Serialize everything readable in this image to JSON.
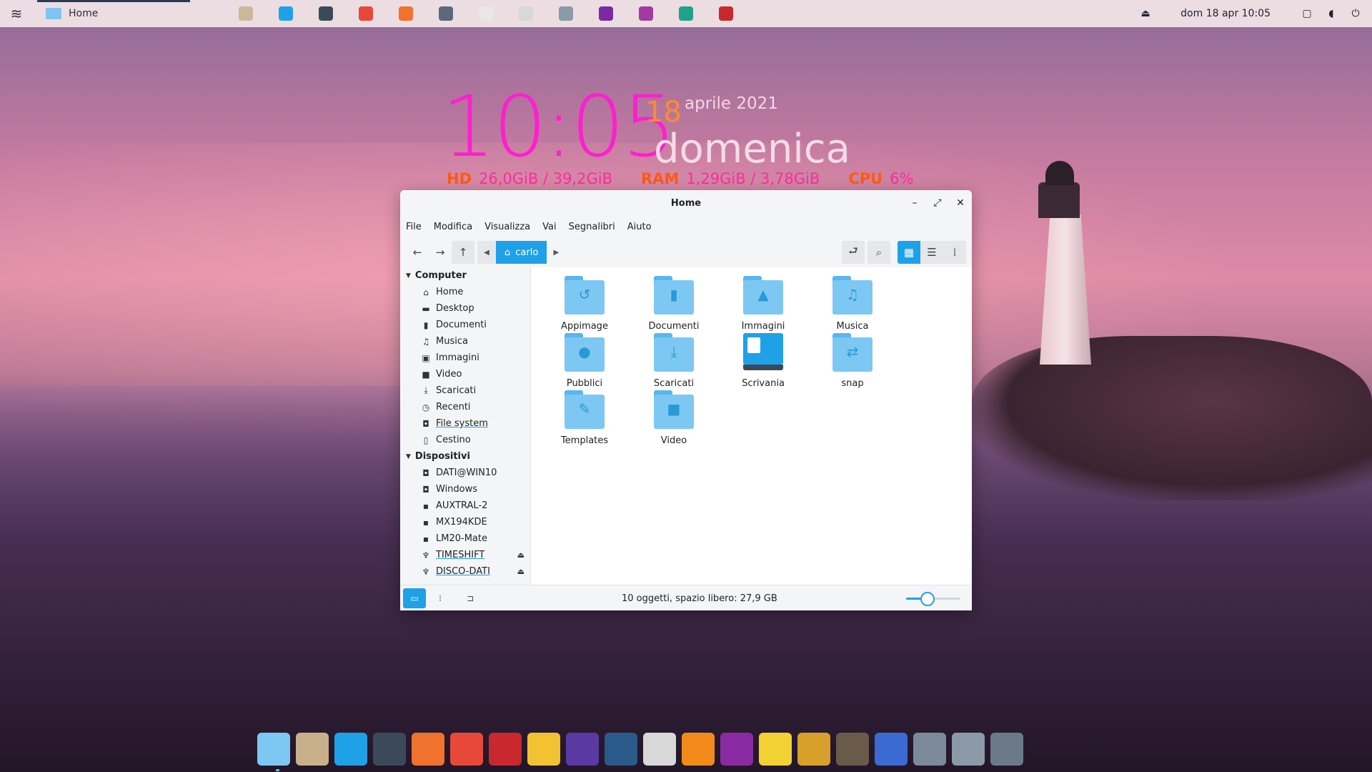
{
  "top_panel": {
    "active_window": "Home",
    "clock": "dom 18 apr  10:05",
    "launchers": [
      "file-manager",
      "software-center",
      "terminal",
      "chrome",
      "firefox",
      "calculator",
      "text-editor",
      "scanner",
      "screenshot",
      "video-recorder",
      "media",
      "audio",
      "cm-app"
    ],
    "tray_icons": [
      "eject-icon",
      "screen-icon",
      "volume-icon",
      "power-icon"
    ]
  },
  "conky": {
    "time": "10:05",
    "day": "18",
    "month_year": "aprile 2021",
    "weekday": "domenica",
    "hd_label": "HD",
    "hd_value": "26,0GiB / 39,2GiB",
    "ram_label": "RAM",
    "ram_value": "1,29GiB / 3,78GiB",
    "cpu_label": "CPU",
    "cpu_value": "6%"
  },
  "window": {
    "title": "Home",
    "menu": [
      "File",
      "Modifica",
      "Visualizza",
      "Vai",
      "Segnalibri",
      "Aiuto"
    ],
    "breadcrumb": "carlo",
    "sidebar": {
      "computer_heading": "Computer",
      "computer_items": [
        {
          "label": "Home",
          "icon": "home-icon",
          "glyph": "⌂"
        },
        {
          "label": "Desktop",
          "icon": "desktop-icon",
          "glyph": "▬"
        },
        {
          "label": "Documenti",
          "icon": "document-icon",
          "glyph": "▮"
        },
        {
          "label": "Musica",
          "icon": "music-icon",
          "glyph": "♫"
        },
        {
          "label": "Immagini",
          "icon": "image-icon",
          "glyph": "▣"
        },
        {
          "label": "Video",
          "icon": "video-icon",
          "glyph": "■"
        },
        {
          "label": "Scaricati",
          "icon": "download-icon",
          "glyph": "⤓"
        },
        {
          "label": "Recenti",
          "icon": "clock-icon",
          "glyph": "◷"
        },
        {
          "label": "File system",
          "icon": "drive-icon",
          "glyph": "◘"
        },
        {
          "label": "Cestino",
          "icon": "trash-icon",
          "glyph": "▯"
        }
      ],
      "devices_heading": "Dispositivi",
      "device_items": [
        {
          "label": "DATI@WIN10",
          "icon": "drive-icon",
          "glyph": "◘"
        },
        {
          "label": "Windows",
          "icon": "drive-icon",
          "glyph": "◘"
        },
        {
          "label": "AUXTRAL-2",
          "icon": "drive-icon",
          "glyph": "▪"
        },
        {
          "label": "MX194KDE",
          "icon": "drive-icon",
          "glyph": "▪"
        },
        {
          "label": "LM20-Mate",
          "icon": "drive-icon",
          "glyph": "▪"
        },
        {
          "label": "TIMESHIFT",
          "icon": "usb-icon",
          "glyph": "♆",
          "eject": "⏏"
        },
        {
          "label": "DISCO-DATI",
          "icon": "usb-icon",
          "glyph": "♆",
          "eject": "⏏"
        }
      ]
    },
    "files": [
      {
        "name": "Appimage",
        "icon": "folder-appimage-icon",
        "glyph": "↺"
      },
      {
        "name": "Documenti",
        "icon": "folder-documents-icon",
        "glyph": "▮"
      },
      {
        "name": "Immagini",
        "icon": "folder-pictures-icon",
        "glyph": "▲"
      },
      {
        "name": "Musica",
        "icon": "folder-music-icon",
        "glyph": "♫"
      },
      {
        "name": "Pubblici",
        "icon": "folder-public-icon",
        "glyph": "●"
      },
      {
        "name": "Scaricati",
        "icon": "folder-download-icon",
        "glyph": "⤓"
      },
      {
        "name": "Scrivania",
        "icon": "desktop-folder-icon",
        "glyph": ""
      },
      {
        "name": "snap",
        "icon": "folder-snap-icon",
        "glyph": "⇄"
      },
      {
        "name": "Templates",
        "icon": "folder-templates-icon",
        "glyph": "✎"
      },
      {
        "name": "Video",
        "icon": "folder-video-icon",
        "glyph": "■"
      }
    ],
    "status": "10 oggetti, spazio libero: 27,9 GB",
    "zoom_level": 0.38
  },
  "dock": [
    {
      "name": "files-dock-icon",
      "color": "#7cc8f2"
    },
    {
      "name": "archive-dock-icon",
      "color": "#c8b08a"
    },
    {
      "name": "software-dock-icon",
      "color": "#1fa1e8"
    },
    {
      "name": "terminal-dock-icon",
      "color": "#3b4a5a"
    },
    {
      "name": "firefox-dock-icon",
      "color": "#f0722c"
    },
    {
      "name": "chrome-dock-icon",
      "color": "#e8483a"
    },
    {
      "name": "transfer-dock-icon",
      "color": "#c8282e"
    },
    {
      "name": "mail-dock-icon",
      "color": "#f2c232"
    },
    {
      "name": "audio-dock-icon",
      "color": "#5a3aa2"
    },
    {
      "name": "video-player-dock-icon",
      "color": "#2a5a8a"
    },
    {
      "name": "disc-burner-dock-icon",
      "color": "#d8d8d8"
    },
    {
      "name": "vlc-dock-icon",
      "color": "#f28a1a"
    },
    {
      "name": "video-editor-dock-icon",
      "color": "#8a2aa2"
    },
    {
      "name": "rhythmbox-dock-icon",
      "color": "#f2d232"
    },
    {
      "name": "radio-dock-icon",
      "color": "#d8a02a"
    },
    {
      "name": "gimp-dock-icon",
      "color": "#6a5a4a"
    },
    {
      "name": "document-dock-icon",
      "color": "#3a6ad2"
    },
    {
      "name": "settings-disk-dock-icon",
      "color": "#7a8a9a"
    },
    {
      "name": "backup-dock-icon",
      "color": "#8a9aa8"
    },
    {
      "name": "settings-dock-icon",
      "color": "#6a7a88"
    }
  ]
}
